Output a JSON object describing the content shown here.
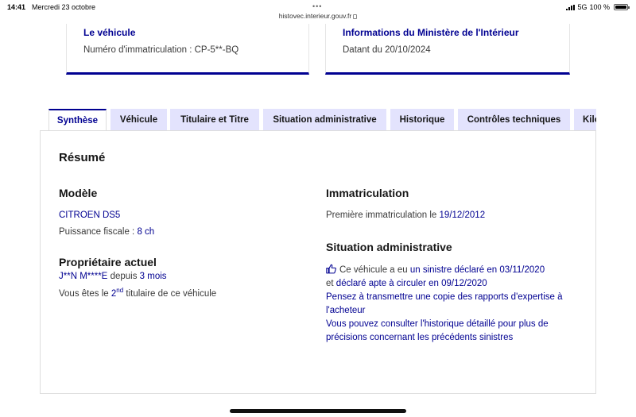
{
  "status_bar": {
    "time": "14:41",
    "date": "Mercredi 23 octobre",
    "url": "histovec.interieur.gouv.fr",
    "network": "5G",
    "battery": "100 %"
  },
  "cards": {
    "vehicle": {
      "title": "Le véhicule",
      "text": "Numéro d'immatriculation : CP-5**-BQ"
    },
    "ministere": {
      "title": "Informations du Ministère de l'Intérieur",
      "text": "Datant du 20/10/2024"
    }
  },
  "tabs": [
    {
      "label": "Synthèse",
      "active": true
    },
    {
      "label": "Véhicule",
      "active": false
    },
    {
      "label": "Titulaire et Titre",
      "active": false
    },
    {
      "label": "Situation administrative",
      "active": false
    },
    {
      "label": "Historique",
      "active": false
    },
    {
      "label": "Contrôles techniques",
      "active": false
    },
    {
      "label": "Kilométrage",
      "active": false
    }
  ],
  "summary": {
    "title": "Résumé",
    "modele": {
      "heading": "Modèle",
      "name": "CITROEN DS5",
      "puissance_label": "Puissance fiscale :",
      "puissance_value": "8 ch"
    },
    "proprietaire": {
      "heading": "Propriétaire actuel",
      "name": "J**N M****E",
      "depuis_label": "depuis",
      "depuis_value": "3 mois",
      "rank_prefix": "Vous êtes le",
      "rank_number": "2",
      "rank_sup": "nd",
      "rank_suffix": "titulaire de ce véhicule"
    },
    "immatriculation": {
      "heading": "Immatriculation",
      "label": "Première immatriculation le",
      "date": "19/12/2012"
    },
    "situation": {
      "heading": "Situation administrative",
      "line1_prefix": "Ce véhicule a eu",
      "line1_link": "un sinistre déclaré en 03/11/2020",
      "line2_prefix": "et",
      "line2_link": "déclaré apte à circuler en 09/12/2020",
      "advice1_l1": "Pensez à transmettre une copie des rapports d'expertise à",
      "advice1_l2": "l'acheteur",
      "advice2_l1": "Vous pouvez consulter l'historique détaillé pour plus de",
      "advice2_l2": "précisions concernant les précédents sinistres"
    }
  },
  "icons": {
    "situation": "thumbs-up-icon"
  },
  "colors": {
    "accent": "#000091",
    "tab_background": "#e3e3fd"
  }
}
